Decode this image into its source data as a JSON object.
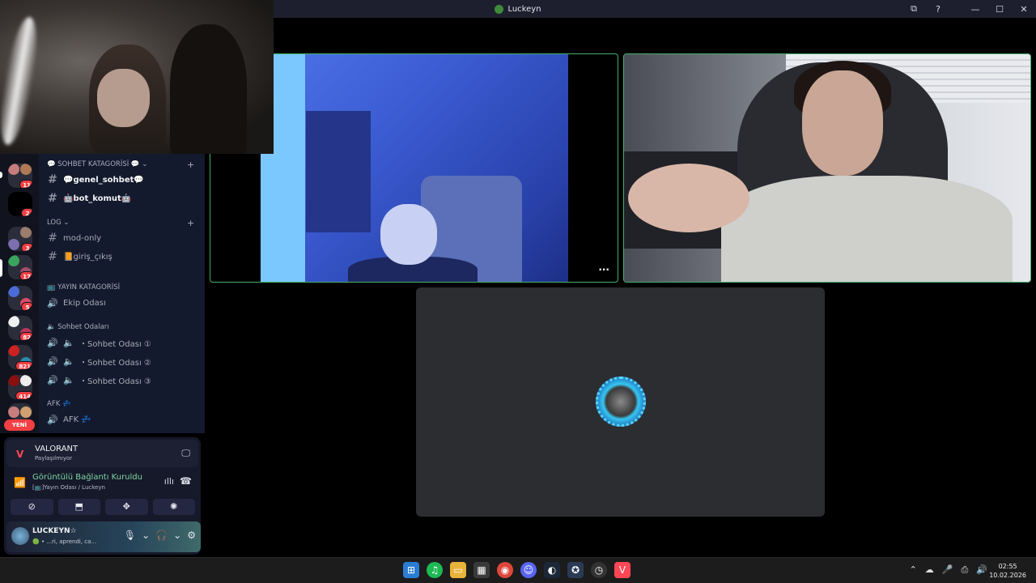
{
  "window": {
    "title": "Luckeyn",
    "controls": [
      "⧉",
      "?",
      "—",
      "☐",
      "✕"
    ]
  },
  "servers": [
    {
      "badge": "11"
    },
    {
      "badge": "2"
    },
    {
      "badge": "3"
    },
    {
      "badge": "17"
    },
    {
      "badge": "5"
    },
    {
      "badge": "82"
    },
    {
      "badge": "821"
    },
    {
      "badge": "414"
    }
  ],
  "new_label": "YENİ",
  "sidebar": {
    "categories": {
      "sohbet": "💬 SOHBET KATAGORİSİ 💬 ⌄",
      "log": "LOG ⌄",
      "yayin": "📺 YAYIN KATAGORİSİ",
      "sohbet_odalari": "🔈 Sohbet Odaları",
      "afk": "AFK 💤"
    },
    "channels": {
      "genel": "💬genel_sohbet💬",
      "bot": "🤖bot_komut🤖",
      "mod": "mod-only",
      "giris": "📙giriş_çıkış",
      "ekip": "Ekip Odası",
      "oda1": "・Sohbet Odası ①",
      "oda2": "・Sohbet Odası ②",
      "oda3": "・Sohbet Odası ③",
      "afk": "AFK 💤"
    }
  },
  "panel": {
    "stream_title": "VALORANT",
    "stream_sub": "Paylaşılmıyor",
    "connection_title": "Görüntülü Bağlantı Kuruldu",
    "connection_sub": "[📺]Yayın Odası / Luckeyn",
    "user_name": "LUCKEYN☆",
    "user_status": "🟢 • ...ri, aprendi, ca..."
  },
  "call": {
    "more_label": "···"
  },
  "taskbar": {
    "time": "02:55",
    "date": "10.02.2026",
    "tray_icons": [
      "⌃",
      "☁",
      "🎤",
      "⎙",
      "🔊"
    ]
  }
}
